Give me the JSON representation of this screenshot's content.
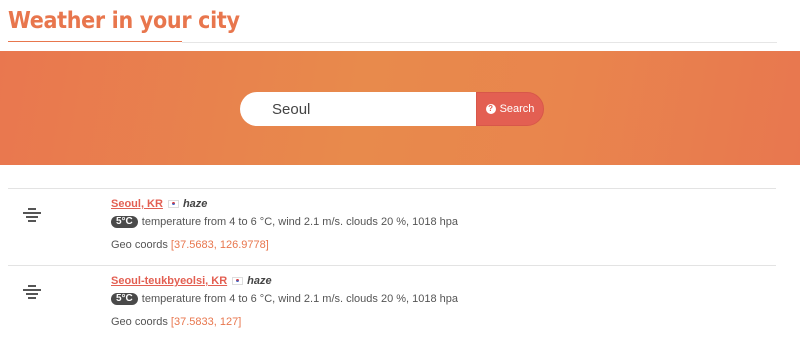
{
  "header": {
    "title": "Weather in your city"
  },
  "search": {
    "value": "Seoul",
    "button_label": "Search",
    "button_icon": "question-circle-icon"
  },
  "colors": {
    "accent": "#e8764d",
    "button": "#e35f52",
    "badge": "#4a4a4a"
  },
  "results": [
    {
      "city": "Seoul, KR",
      "flag": "kr-flag-icon",
      "description": "haze",
      "temp_badge": "5°C",
      "details": "temperature from 4 to 6 °C, wind 2.1 m/s. clouds 20 %, 1018 hpa",
      "geo_label": "Geo coords",
      "geo_coords": "[37.5683, 126.9778]",
      "icon": "haze-icon"
    },
    {
      "city": "Seoul-teukbyeolsi, KR",
      "flag": "kr-flag-icon",
      "description": "haze",
      "temp_badge": "5°C",
      "details": "temperature from 4 to 6 °C, wind 2.1 m/s. clouds 20 %, 1018 hpa",
      "geo_label": "Geo coords",
      "geo_coords": "[37.5833, 127]",
      "icon": "haze-icon"
    }
  ]
}
